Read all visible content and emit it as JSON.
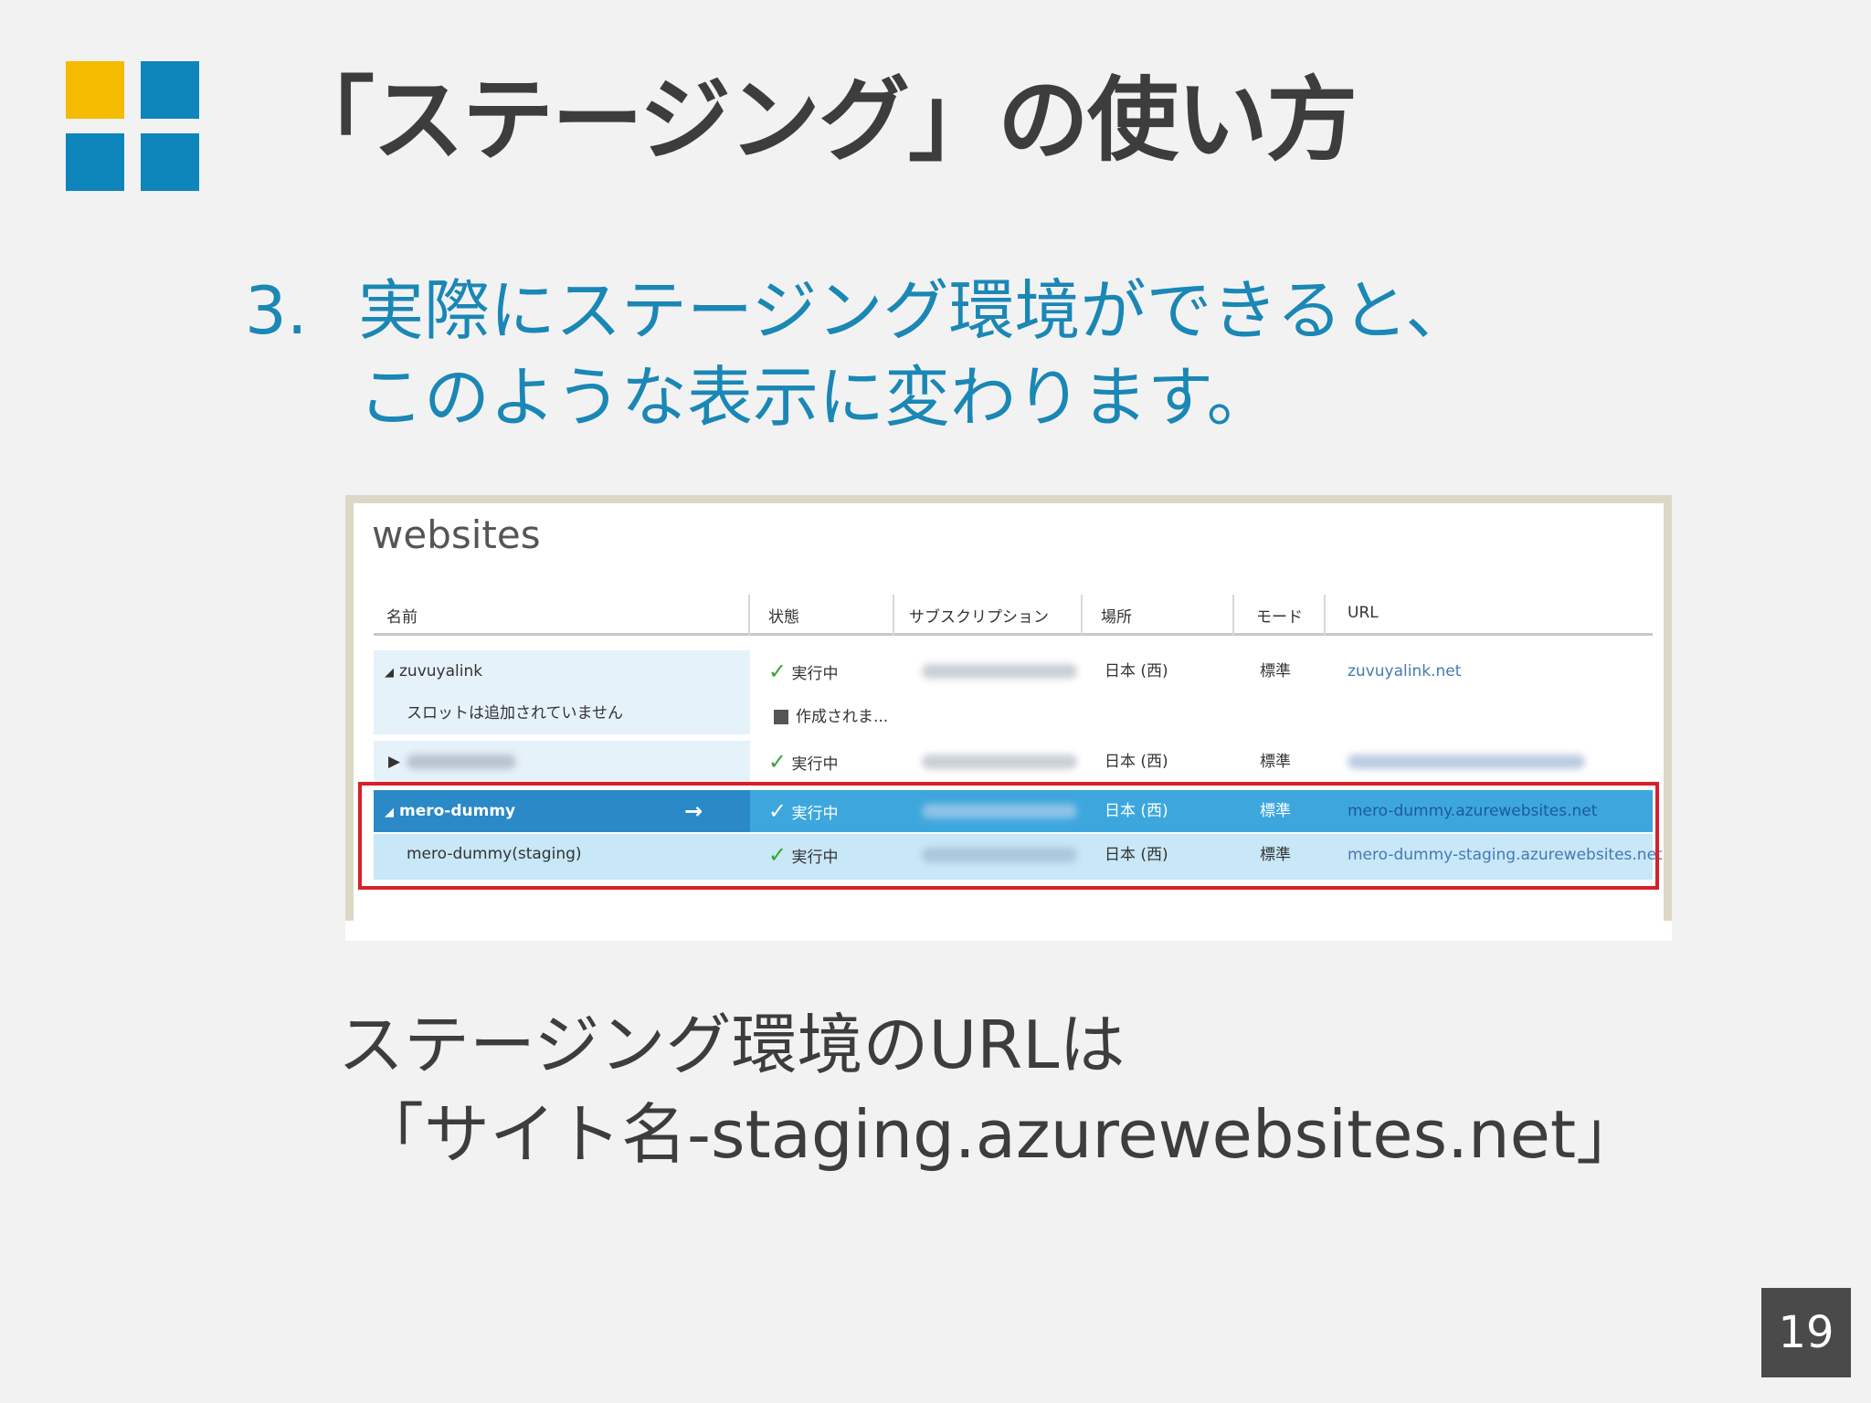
{
  "title": "「ステージング」の使い方",
  "logo": {
    "colors": [
      "#f5bb00",
      "#0e85bb",
      "#0e85bb",
      "#0e85bb"
    ]
  },
  "step": {
    "number": "3.",
    "line1": "実際にステージング環境ができると、",
    "line2": "このような表示に変わります。"
  },
  "screenshot": {
    "heading": "websites",
    "columns": [
      "名前",
      "状態",
      "サブスクリプション",
      "場所",
      "モード",
      "URL"
    ],
    "rows": [
      {
        "name": "zuvuyalink",
        "status": "実行中",
        "location": "日本 (西)",
        "mode": "標準",
        "url": "zuvuyalink.net"
      },
      {
        "name": "スロットは追加されていません",
        "status": "作成されま..."
      },
      {
        "status": "実行中",
        "location": "日本 (西)",
        "mode": "標準"
      },
      {
        "name": "mero-dummy",
        "status": "実行中",
        "location": "日本 (西)",
        "mode": "標準",
        "url": "mero-dummy.azurewebsites.net"
      },
      {
        "name": "mero-dummy(staging)",
        "status": "実行中",
        "location": "日本 (西)",
        "mode": "標準",
        "url": "mero-dummy-staging.azurewebsites.net"
      }
    ],
    "highlight_color": "#d6202a"
  },
  "note": {
    "line1": "ステージング環境のURLは",
    "line2": "「サイト名-staging.azurewebsites.net」"
  },
  "page_number": "19"
}
